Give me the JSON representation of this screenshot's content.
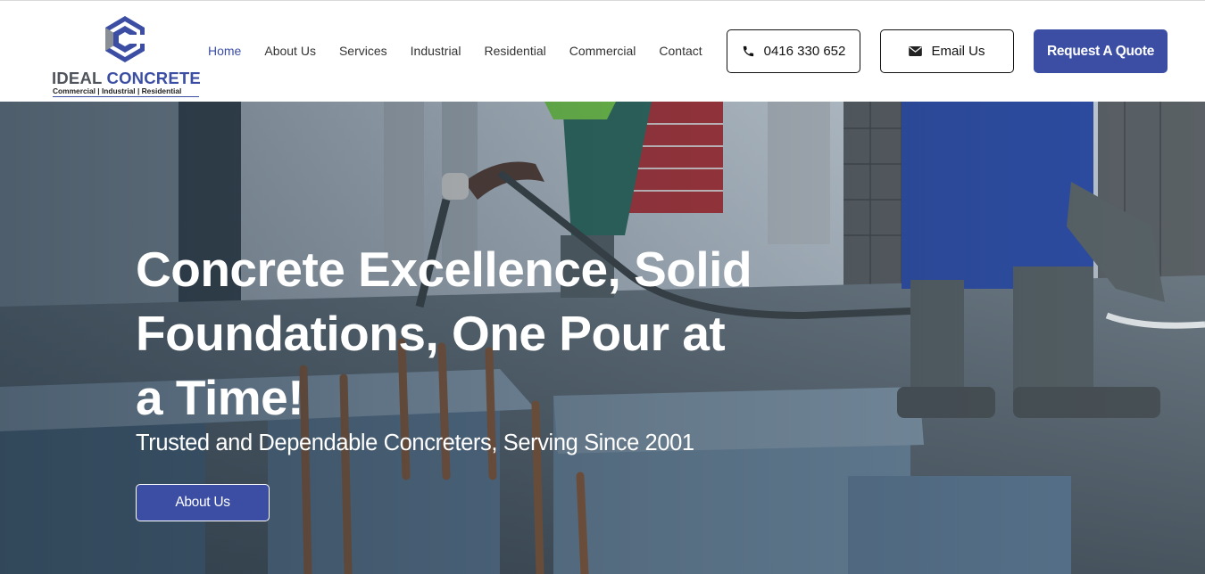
{
  "brand": {
    "name_part1": "IDEAL",
    "name_part2": "CONCRETE",
    "tagline": "Commercial | Industrial | Residential",
    "colors": {
      "primary": "#3b4ea3",
      "logo_grey": "#4f545c"
    }
  },
  "nav": {
    "items": [
      {
        "label": "Home",
        "active": true
      },
      {
        "label": "About Us",
        "active": false
      },
      {
        "label": "Services",
        "active": false
      },
      {
        "label": "Industrial",
        "active": false
      },
      {
        "label": "Residential",
        "active": false
      },
      {
        "label": "Commercial",
        "active": false
      },
      {
        "label": "Contact",
        "active": false
      }
    ]
  },
  "header_actions": {
    "phone_label": "0416 330 652",
    "phone_icon": "phone-icon",
    "email_label": "Email Us",
    "email_icon": "envelope-icon",
    "quote_label": "Request A Quote"
  },
  "hero": {
    "title_lines": [
      "Concrete Excellence, Solid",
      "Foundations, One Pour at",
      "a Time!"
    ],
    "subtitle": "Trusted and Dependable Concreters, Serving Since 2001",
    "cta_label": "About Us"
  }
}
